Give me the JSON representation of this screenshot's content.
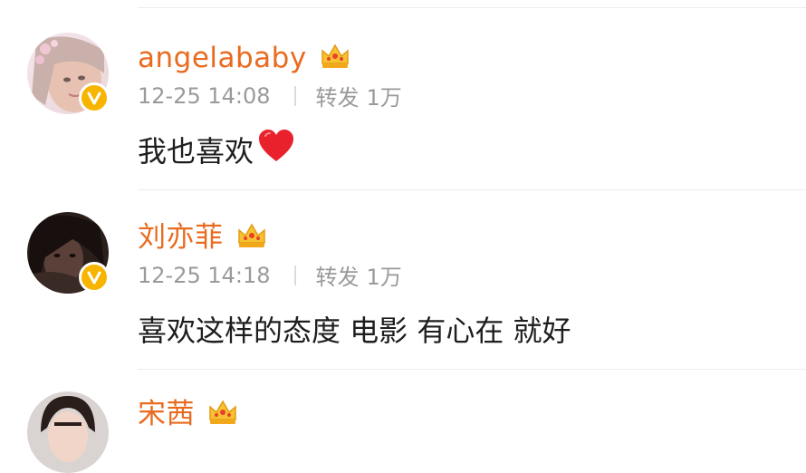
{
  "comments": [
    {
      "username": "angelababy",
      "time": "12-25 14:08",
      "repost_label": "转发",
      "repost_count": "1万",
      "text": "我也喜欢",
      "emoji": "heart-icon",
      "verified": true,
      "vip_badge": "crown-icon"
    },
    {
      "username": "刘亦菲",
      "time": "12-25 14:18",
      "repost_label": "转发",
      "repost_count": "1万",
      "text": "喜欢这样的态度 电影 有心在 就好",
      "verified": true,
      "vip_badge": "crown-icon"
    },
    {
      "username": "宋茜",
      "verified": true,
      "vip_badge": "crown-icon"
    }
  ],
  "colors": {
    "username": "#e86b1f",
    "meta": "#9a9a9a",
    "verified": "#f7b500",
    "heart": "#e8212d"
  }
}
